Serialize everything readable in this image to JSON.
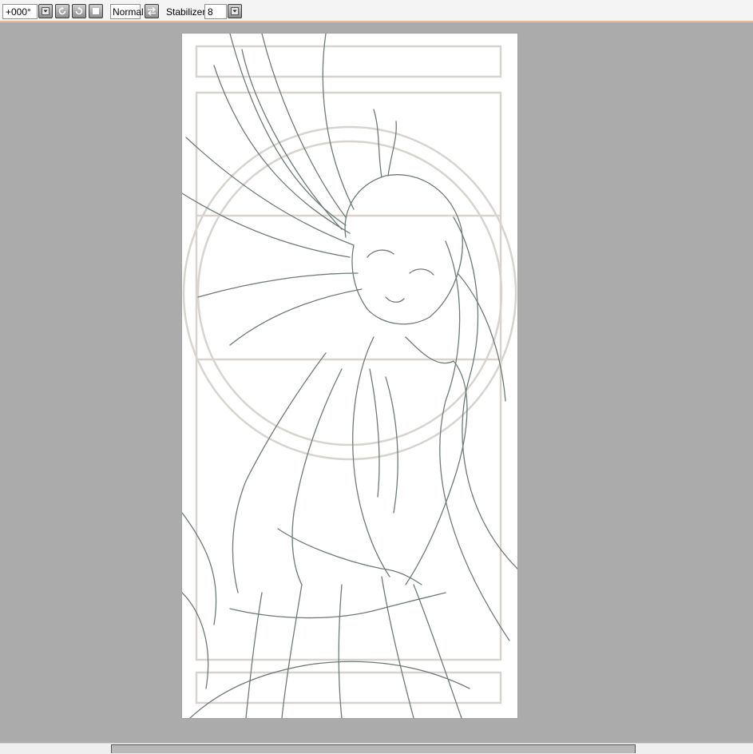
{
  "toolbar": {
    "rotation_value": "+000°",
    "blend_mode": "Normal",
    "stabilizer_label": "Stabilizer",
    "stabilizer_value": "8"
  },
  "icons": {
    "rotation_dropdown": "chevron-down-icon",
    "rotate_left": "rotate-left-icon",
    "rotate_right": "rotate-right-icon",
    "reset_rotation": "reset-square-icon",
    "flip": "flip-horizontal-icon",
    "stabilizer_dropdown": "chevron-down-icon"
  },
  "colors": {
    "workspace": "#ababab",
    "paper": "#ffffff",
    "sketch_line": "#6f7a76",
    "guide_line": "#d7d4cf"
  }
}
